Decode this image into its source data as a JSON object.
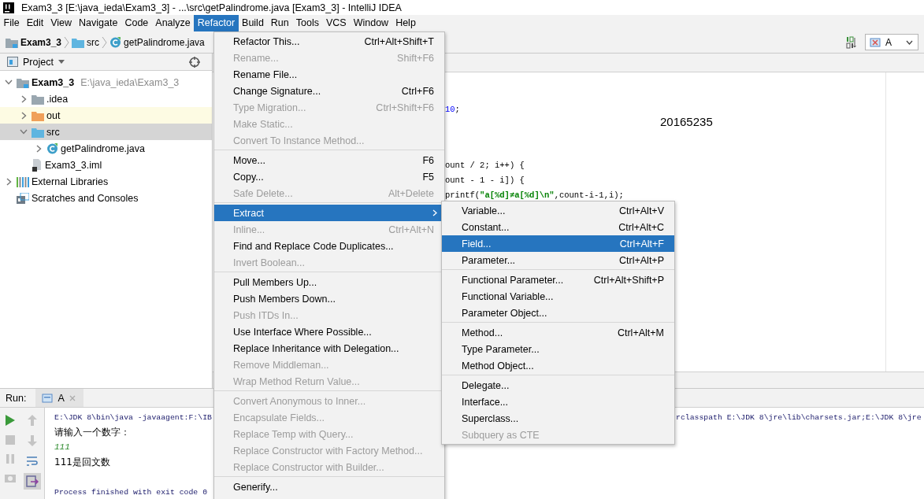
{
  "window": {
    "title": "Exam3_3 [E:\\java_ieda\\Exam3_3] - ...\\src\\getPalindrome.java [Exam3_3] - IntelliJ IDEA"
  },
  "menu_bar": [
    {
      "label": "File",
      "selected": false
    },
    {
      "label": "Edit",
      "selected": false
    },
    {
      "label": "View",
      "selected": false
    },
    {
      "label": "Navigate",
      "selected": false
    },
    {
      "label": "Code",
      "selected": false
    },
    {
      "label": "Analyze",
      "selected": false
    },
    {
      "label": "Refactor",
      "selected": true
    },
    {
      "label": "Build",
      "selected": false
    },
    {
      "label": "Run",
      "selected": false
    },
    {
      "label": "Tools",
      "selected": false
    },
    {
      "label": "VCS",
      "selected": false
    },
    {
      "label": "Window",
      "selected": false
    },
    {
      "label": "Help",
      "selected": false
    }
  ],
  "navigation_bar": {
    "breadcrumbs": [
      {
        "label": "Exam3_3",
        "kind": "module"
      },
      {
        "label": "src",
        "kind": "folder-source"
      },
      {
        "label": "getPalindrome.java",
        "kind": "class"
      }
    ],
    "run_config": "A"
  },
  "project_panel": {
    "title": "Project",
    "tree": [
      {
        "label": "Exam3_3",
        "note": "E:\\java_ieda\\Exam3_3",
        "kind": "module",
        "expanded": true,
        "selected": false,
        "children": [
          {
            "label": ".idea",
            "kind": "folder",
            "expanded": false,
            "selected": false
          },
          {
            "label": "out",
            "kind": "folder-excluded",
            "expanded": false,
            "selected": false
          },
          {
            "label": "src",
            "kind": "folder-source",
            "expanded": true,
            "selected": true,
            "children": [
              {
                "label": "getPalindrome.java",
                "kind": "class",
                "expanded": false,
                "selected": false
              }
            ]
          },
          {
            "label": "Exam3_3.iml",
            "kind": "iml",
            "selected": false
          }
        ]
      },
      {
        "label": "External Libraries",
        "kind": "libraries",
        "expanded": false,
        "selected": false
      },
      {
        "label": "Scratches and Consoles",
        "kind": "scratches",
        "selected": false
      }
    ]
  },
  "editor": {
    "top_lines": [
      [
        {
          "text": "10",
          "kind": "number"
        },
        {
          "text": ";",
          "kind": "plain"
        }
      ]
    ],
    "note": "20165235",
    "lines": [
      [
        {
          "text": "ount / 2; i++) {",
          "kind": "plain"
        }
      ],
      [
        {
          "text": "ount - 1 - i]) {",
          "kind": "plain"
        }
      ],
      [
        {
          "text": "printf(",
          "kind": "plain"
        },
        {
          "text": "\"a[%d]≠a[%d]\\n\"",
          "kind": "string"
        },
        {
          "text": ",count-i-1,i);",
          "kind": "plain"
        }
      ]
    ]
  },
  "run_panel": {
    "title": "Run:",
    "tab": "A",
    "console": [
      {
        "text": "E:\\JDK 8\\bin\\java -javaagent:F:\\IB",
        "continuation": "rclasspath E:\\JDK 8\\jre\\lib\\charsets.jar;E:\\JDK 8\\jre",
        "kind": "command"
      },
      {
        "text": "请输入一个数字：",
        "kind": "output"
      },
      {
        "text": "111",
        "kind": "input"
      },
      {
        "text": "111是回文数",
        "kind": "output"
      },
      {
        "text": "Process finished with exit code 0",
        "kind": "exit"
      }
    ]
  },
  "refactor_menu": {
    "groups": [
      [
        {
          "label": "Refactor This...",
          "shortcut": "Ctrl+Alt+Shift+T",
          "disabled": false,
          "selected": false,
          "kind": "item"
        },
        {
          "label": "Rename...",
          "shortcut": "Shift+F6",
          "disabled": true,
          "selected": false,
          "kind": "item"
        },
        {
          "label": "Rename File...",
          "disabled": false,
          "selected": false,
          "kind": "item"
        },
        {
          "label": "Change Signature...",
          "shortcut": "Ctrl+F6",
          "disabled": false,
          "selected": false,
          "kind": "item"
        },
        {
          "label": "Type Migration...",
          "shortcut": "Ctrl+Shift+F6",
          "disabled": true,
          "selected": false,
          "kind": "item"
        },
        {
          "label": "Make Static...",
          "disabled": true,
          "selected": false,
          "kind": "item"
        },
        {
          "label": "Convert To Instance Method...",
          "disabled": true,
          "selected": false,
          "kind": "item"
        }
      ],
      [
        {
          "label": "Move...",
          "shortcut": "F6",
          "disabled": false,
          "selected": false,
          "kind": "item"
        },
        {
          "label": "Copy...",
          "shortcut": "F5",
          "disabled": false,
          "selected": false,
          "kind": "item"
        },
        {
          "label": "Safe Delete...",
          "shortcut": "Alt+Delete",
          "disabled": true,
          "selected": false,
          "kind": "item"
        }
      ],
      [
        {
          "label": "Extract",
          "disabled": false,
          "selected": true,
          "kind": "submenu"
        },
        {
          "label": "Inline...",
          "shortcut": "Ctrl+Alt+N",
          "disabled": true,
          "selected": false,
          "kind": "item"
        },
        {
          "label": "Find and Replace Code Duplicates...",
          "disabled": false,
          "selected": false,
          "kind": "item"
        },
        {
          "label": "Invert Boolean...",
          "disabled": true,
          "selected": false,
          "kind": "item"
        }
      ],
      [
        {
          "label": "Pull Members Up...",
          "disabled": false,
          "selected": false,
          "kind": "item"
        },
        {
          "label": "Push Members Down...",
          "disabled": false,
          "selected": false,
          "kind": "item"
        },
        {
          "label": "Push ITDs In...",
          "disabled": true,
          "selected": false,
          "kind": "item"
        },
        {
          "label": "Use Interface Where Possible...",
          "disabled": false,
          "selected": false,
          "kind": "item"
        },
        {
          "label": "Replace Inheritance with Delegation...",
          "disabled": false,
          "selected": false,
          "kind": "item"
        },
        {
          "label": "Remove Middleman...",
          "disabled": true,
          "selected": false,
          "kind": "item"
        },
        {
          "label": "Wrap Method Return Value...",
          "disabled": true,
          "selected": false,
          "kind": "item"
        }
      ],
      [
        {
          "label": "Convert Anonymous to Inner...",
          "disabled": true,
          "selected": false,
          "kind": "item"
        },
        {
          "label": "Encapsulate Fields...",
          "disabled": true,
          "selected": false,
          "kind": "item"
        },
        {
          "label": "Replace Temp with Query...",
          "disabled": true,
          "selected": false,
          "kind": "item"
        },
        {
          "label": "Replace Constructor with Factory Method...",
          "disabled": true,
          "selected": false,
          "kind": "item"
        },
        {
          "label": "Replace Constructor with Builder...",
          "disabled": true,
          "selected": false,
          "kind": "item"
        }
      ],
      [
        {
          "label": "Generify...",
          "disabled": false,
          "selected": false,
          "kind": "item"
        }
      ]
    ]
  },
  "extract_submenu": {
    "groups": [
      [
        {
          "label": "Variable...",
          "shortcut": "Ctrl+Alt+V",
          "disabled": false,
          "selected": false,
          "kind": "item"
        },
        {
          "label": "Constant...",
          "shortcut": "Ctrl+Alt+C",
          "disabled": false,
          "selected": false,
          "kind": "item"
        },
        {
          "label": "Field...",
          "shortcut": "Ctrl+Alt+F",
          "disabled": false,
          "selected": true,
          "kind": "item"
        },
        {
          "label": "Parameter...",
          "shortcut": "Ctrl+Alt+P",
          "disabled": false,
          "selected": false,
          "kind": "item"
        }
      ],
      [
        {
          "label": "Functional Parameter...",
          "shortcut": "Ctrl+Alt+Shift+P",
          "disabled": false,
          "selected": false,
          "kind": "item"
        },
        {
          "label": "Functional Variable...",
          "disabled": false,
          "selected": false,
          "kind": "item"
        },
        {
          "label": "Parameter Object...",
          "disabled": false,
          "selected": false,
          "kind": "item"
        }
      ],
      [
        {
          "label": "Method...",
          "shortcut": "Ctrl+Alt+M",
          "disabled": false,
          "selected": false,
          "kind": "item"
        },
        {
          "label": "Type Parameter...",
          "disabled": false,
          "selected": false,
          "kind": "item"
        },
        {
          "label": "Method Object...",
          "disabled": false,
          "selected": false,
          "kind": "item"
        }
      ],
      [
        {
          "label": "Delegate...",
          "disabled": false,
          "selected": false,
          "kind": "item"
        },
        {
          "label": "Interface...",
          "disabled": false,
          "selected": false,
          "kind": "item"
        },
        {
          "label": "Superclass...",
          "disabled": false,
          "selected": false,
          "kind": "item"
        },
        {
          "label": "Subquery as CTE",
          "disabled": true,
          "selected": false,
          "kind": "item"
        }
      ]
    ]
  }
}
